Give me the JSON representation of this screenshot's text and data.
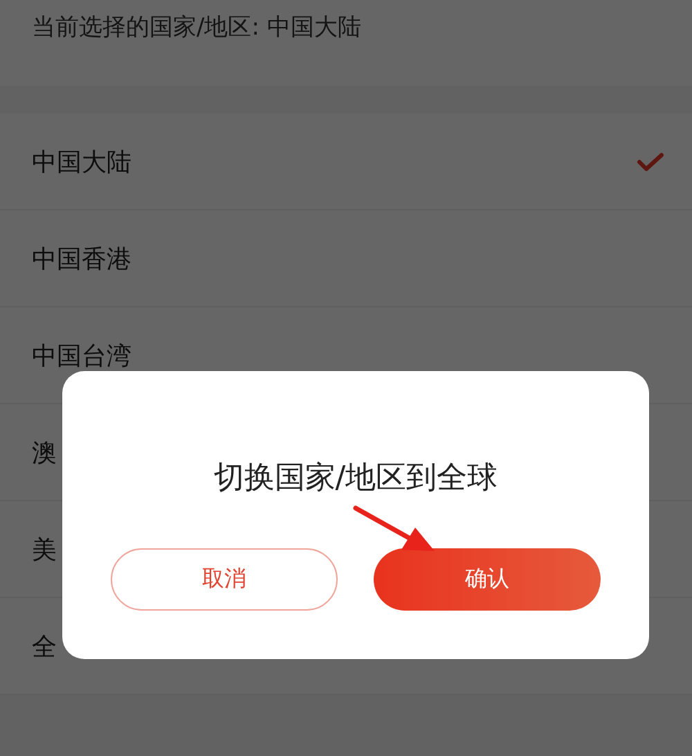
{
  "current_region": {
    "label": "当前选择的国家/地区: 中国大陆"
  },
  "regions": [
    {
      "name": "中国大陆",
      "selected": true
    },
    {
      "name": "中国香港",
      "selected": false
    },
    {
      "name": "中国台湾",
      "selected": false
    },
    {
      "name": "澳",
      "selected": false
    },
    {
      "name": "美",
      "selected": false
    },
    {
      "name": "全",
      "selected": false
    }
  ],
  "dialog": {
    "title": "切换国家/地区到全球",
    "cancel": "取消",
    "confirm": "确认"
  }
}
